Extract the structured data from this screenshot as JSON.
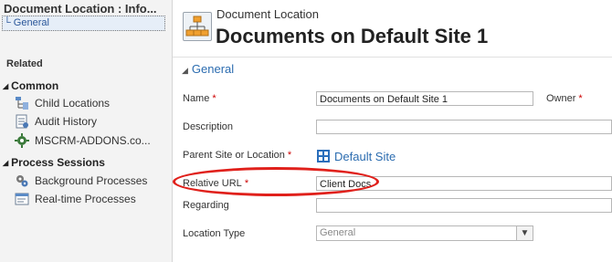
{
  "sidebar": {
    "title": "Document Location : Info...",
    "general": "General",
    "related": "Related",
    "common": {
      "label": "Common",
      "items": [
        "Child Locations",
        "Audit History",
        "MSCRM-ADDONS.co..."
      ]
    },
    "process": {
      "label": "Process Sessions",
      "items": [
        "Background Processes",
        "Real-time Processes"
      ]
    }
  },
  "header": {
    "entity": "Document Location",
    "title": "Documents on Default Site 1"
  },
  "form": {
    "section": "General",
    "name_label": "Name",
    "name_value": "Documents on Default Site 1",
    "owner_label": "Owner",
    "description_label": "Description",
    "parent_label": "Parent Site or Location",
    "parent_value": "Default Site",
    "relative_url_label": "Relative URL",
    "relative_url_value": "Client Docs",
    "regarding_label": "Regarding",
    "location_type_label": "Location Type",
    "location_type_value": "General"
  },
  "colors": {
    "required": "#cc0000",
    "link": "#2b6cb0",
    "highlight": "#e0201b"
  }
}
